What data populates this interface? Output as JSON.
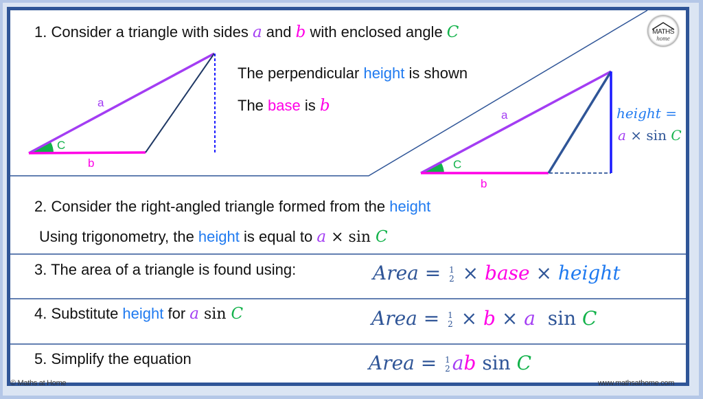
{
  "branding": {
    "logo_line1": "MATHS",
    "logo_line2": "home",
    "copyright": "© Maths at Home",
    "website": "www.mathsathome.com"
  },
  "colors": {
    "side_a": "#a33df3",
    "side_b": "#ff00e6",
    "angle_C": "#12b24a",
    "height": "#1f7af0",
    "border": "#2f5597"
  },
  "step1": {
    "prefix": "1. Consider a triangle with sides ",
    "var_a": "a",
    "mid": " and ",
    "var_b": "b",
    "mid2": " with enclosed angle ",
    "var_C": "C",
    "line2_prefix": "The perpendicular ",
    "line2_height": "height",
    "line2_suffix": " is shown",
    "line3_prefix": "The ",
    "line3_base": "base",
    "line3_mid": " is ",
    "line3_b": "b"
  },
  "diagram_left": {
    "label_a": "a",
    "label_b": "b",
    "label_C": "C"
  },
  "diagram_right": {
    "label_a": "a",
    "label_b": "b",
    "label_C": "C",
    "height_label": "height =",
    "height_expr_a": "a",
    "height_expr_times": " × sin ",
    "height_expr_C": "C"
  },
  "step2": {
    "line1_prefix": "2. Consider the right-angled triangle formed from the ",
    "line1_height": "height",
    "line2_prefix": "Using trigonometry, the ",
    "line2_height": "height",
    "line2_mid": " is equal to ",
    "line2_a": "a",
    "line2_times": " × sin ",
    "line2_C": "C"
  },
  "step3": {
    "text": "3. The area of a triangle is found using:",
    "formula": {
      "lhs": "Area = ",
      "frac_num": "1",
      "frac_den": "2",
      "times1": " × ",
      "base": "base",
      "times2": " × ",
      "height": "height"
    }
  },
  "step4": {
    "prefix": "4. Substitute ",
    "height": "height",
    "mid": " for ",
    "a": "a",
    "sin": " sin ",
    "C": "C",
    "formula": {
      "lhs": "Area = ",
      "frac_num": "1",
      "frac_den": "2",
      "times1": " × ",
      "b": "b",
      "times2": " × ",
      "a": "a",
      "sin": "  sin ",
      "C": "C"
    }
  },
  "step5": {
    "text": "5. Simplify the equation",
    "formula": {
      "lhs": "Area = ",
      "frac_num": "1",
      "frac_den": "2",
      "a": "a",
      "b": "b",
      "sin": " sin ",
      "C": "C"
    }
  }
}
